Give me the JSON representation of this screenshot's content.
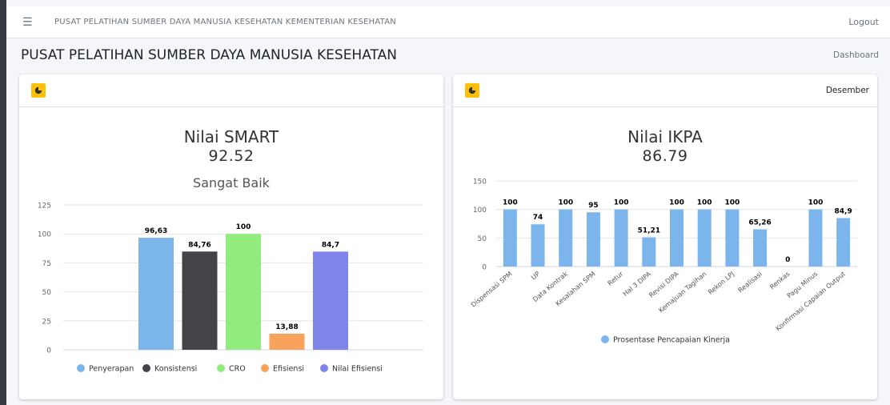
{
  "navbar": {
    "menu_icon": "hamburger-menu-icon",
    "title": "PUSAT PELATIHAN SUMBER DAYA MANUSIA KESEHATAN KEMENTERIAN KESEHATAN",
    "logout_label": "Logout"
  },
  "page": {
    "title": "PUSAT PELATIHAN SUMBER DAYA MANUSIA KESEHATAN",
    "breadcrumb": "Dashboard"
  },
  "smart_card": {
    "icon": "pie-chart-icon",
    "title": "Nilai SMART",
    "value": "92.52",
    "grade": "Sangat Baik"
  },
  "ikpa_card": {
    "icon": "pie-chart-icon",
    "month": "Desember",
    "title": "Nilai IKPA",
    "value": "86.79"
  },
  "colors": {
    "accent": "#ffc107",
    "smart_series": [
      "#7cb5ec",
      "#434348",
      "#90ed7d",
      "#f7a35c",
      "#8085e9"
    ],
    "ikpa_series": "#7cb5ec"
  },
  "chart_data": [
    {
      "type": "bar",
      "categories": [
        "Penyerapan",
        "Konsistensi",
        "CRO",
        "Efisiensi",
        "Nilai Efisiensi"
      ],
      "series": [
        {
          "name": "Penyerapan",
          "values": [
            96.63
          ]
        },
        {
          "name": "Konsistensi",
          "values": [
            84.76
          ]
        },
        {
          "name": "CRO",
          "values": [
            100
          ]
        },
        {
          "name": "Efisiensi",
          "values": [
            13.88
          ]
        },
        {
          "name": "Nilai Efisiensi",
          "values": [
            84.7
          ]
        }
      ],
      "data_labels": [
        "96,63",
        "84,76",
        "100",
        "13,88",
        "84,7"
      ],
      "yticks": [
        "0",
        "25",
        "50",
        "75",
        "100",
        "125"
      ],
      "ylim": [
        0,
        125
      ],
      "grid": true,
      "legend": "bottom"
    },
    {
      "type": "bar",
      "categories": [
        "Dispensasi SPM",
        "UP",
        "Data Kontrak",
        "Kesalahan SPM",
        "Retur",
        "Hal 3 DIPA",
        "Revisi DIPA",
        "Kemajuan Tagihan",
        "Rekon LPJ",
        "Realisasi",
        "Renkas",
        "Pagu Minus",
        "Konfirmasi Capaian Output"
      ],
      "series": [
        {
          "name": "Prosentase Pencapaian Kinerja",
          "values": [
            100,
            74,
            100,
            95,
            100,
            51.21,
            100,
            100,
            100,
            65.26,
            0,
            100,
            84.9
          ]
        }
      ],
      "data_labels": [
        "100",
        "74",
        "100",
        "95",
        "100",
        "51,21",
        "100",
        "100",
        "100",
        "65,26",
        "0",
        "100",
        "84,9"
      ],
      "yticks": [
        "0",
        "50",
        "100",
        "150"
      ],
      "ylim": [
        0,
        150
      ],
      "grid": true,
      "legend": "bottom"
    }
  ]
}
